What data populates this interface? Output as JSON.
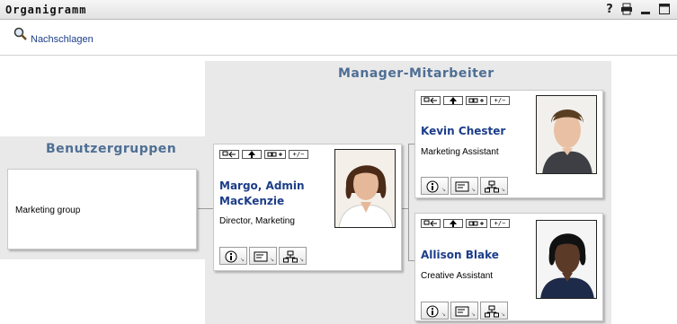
{
  "window": {
    "title": "Organigramm",
    "icons": [
      "help-icon",
      "print-icon",
      "minimize-icon",
      "maximize-icon"
    ],
    "help_glyph": "?"
  },
  "toolbar": {
    "lookup_label": "Nachschlagen"
  },
  "sections": {
    "manager_title": "Manager-Mitarbeiter",
    "groups_title": "Benutzergruppen"
  },
  "groups": {
    "items": [
      "Marketing group"
    ]
  },
  "card_controls": {
    "expand_label": "+/−"
  },
  "manager": {
    "name_line1": "Margo, Admin",
    "name_line2": "MacKenzie",
    "title": "Director, Marketing"
  },
  "reports": [
    {
      "name": "Kevin Chester",
      "title": "Marketing Assistant"
    },
    {
      "name": "Allison Blake",
      "title": "Creative Assistant"
    }
  ],
  "colors": {
    "section_title": "#4f6f94",
    "link": "#1c3d8a",
    "band": "#e9e9e9"
  }
}
